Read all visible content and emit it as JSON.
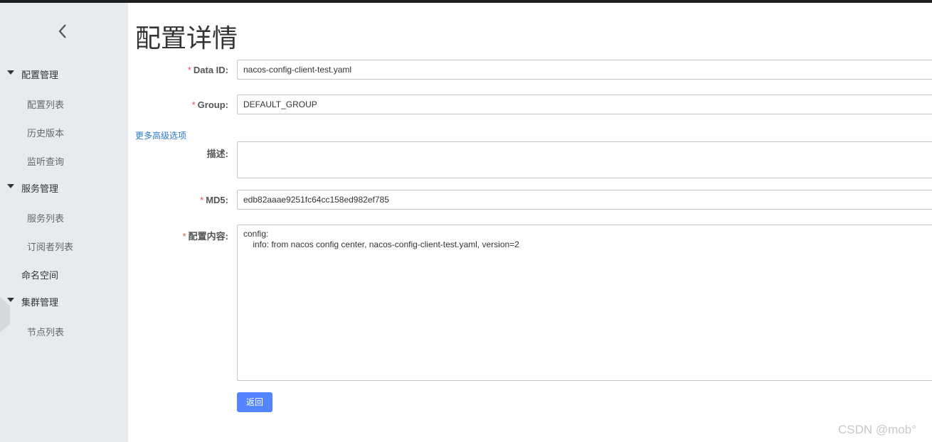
{
  "sidebar": {
    "groups": [
      {
        "label": "配置管理",
        "items": [
          "配置列表",
          "历史版本",
          "监听查询"
        ]
      },
      {
        "label": "服务管理",
        "items": [
          "服务列表",
          "订阅者列表"
        ]
      },
      {
        "label": "命名空间"
      },
      {
        "label": "集群管理",
        "items": [
          "节点列表"
        ]
      }
    ]
  },
  "page": {
    "title": "配置详情"
  },
  "form": {
    "data_id": {
      "label": "Data ID:",
      "value": "nacos-config-client-test.yaml"
    },
    "group": {
      "label": "Group:",
      "value": "DEFAULT_GROUP"
    },
    "advanced_link": "更多高级选项",
    "description": {
      "label": "描述:",
      "value": ""
    },
    "md5": {
      "label": "MD5:",
      "value": "edb82aaae9251fc64cc158ed982ef785"
    },
    "content": {
      "label": "配置内容:",
      "lines": [
        "config:",
        "    info: from nacos config center, nacos-config-client-test.yaml, version=2"
      ]
    },
    "back_button": "返回"
  },
  "required_mark": "*",
  "watermark": "CSDN @mob°",
  "colors": {
    "sidebar_bg": "#e8ebee",
    "primary_button": "#5584ff",
    "link": "#2a7ad3",
    "required": "#e84d4d"
  }
}
